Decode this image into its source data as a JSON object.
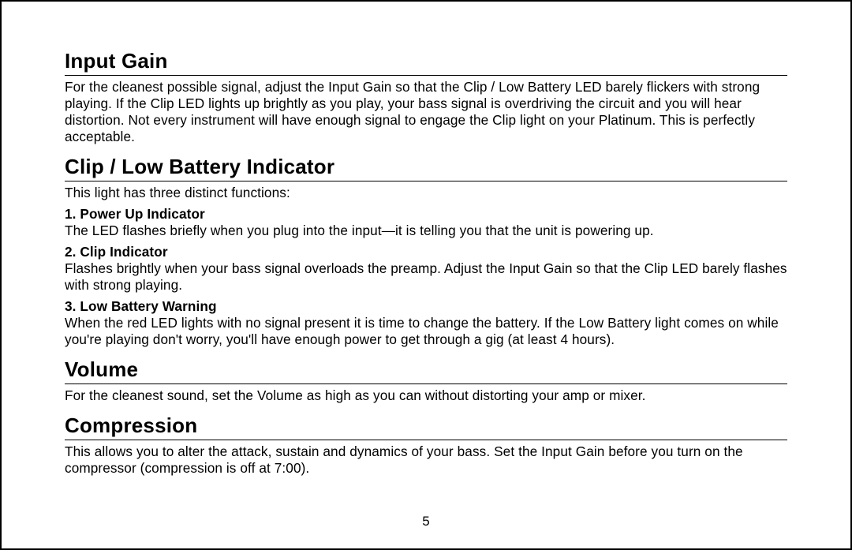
{
  "page_number": "5",
  "sections": {
    "input_gain": {
      "heading": "Input Gain",
      "body": "For the cleanest possible signal, adjust the Input Gain so that the Clip / Low Battery LED barely flickers with strong playing. If the Clip LED lights up brightly as you play, your bass signal is overdriving the circuit and you will hear distortion. Not every instrument will have enough signal to engage the Clip light on your Platinum. This is perfectly acceptable."
    },
    "clip_low_battery": {
      "heading": "Clip / Low Battery Indicator",
      "intro": "This light has three distinct functions:",
      "items": {
        "power_up": {
          "label": "1. Power Up Indicator",
          "body": "The LED flashes briefly when you plug into the input—it is telling you that the unit is powering up."
        },
        "clip": {
          "label": "2. Clip Indicator",
          "body": "Flashes brightly when your bass signal overloads the preamp. Adjust the Input Gain so that the Clip LED barely flashes with strong playing."
        },
        "low_batt": {
          "label": "3. Low Battery Warning",
          "body": "When the red LED lights with no signal present it is time to change the battery. If the Low Battery light comes on while you're playing don't worry, you'll have enough power to get through a gig (at least 4 hours)."
        }
      }
    },
    "volume": {
      "heading": "Volume",
      "body": "For the cleanest sound, set the Volume as high as you can without distorting your amp or mixer."
    },
    "compression": {
      "heading": "Compression",
      "body": "This allows you to alter the attack, sustain and dynamics of your bass. Set the Input Gain before you turn on the compressor (compression is off at 7:00)."
    }
  }
}
